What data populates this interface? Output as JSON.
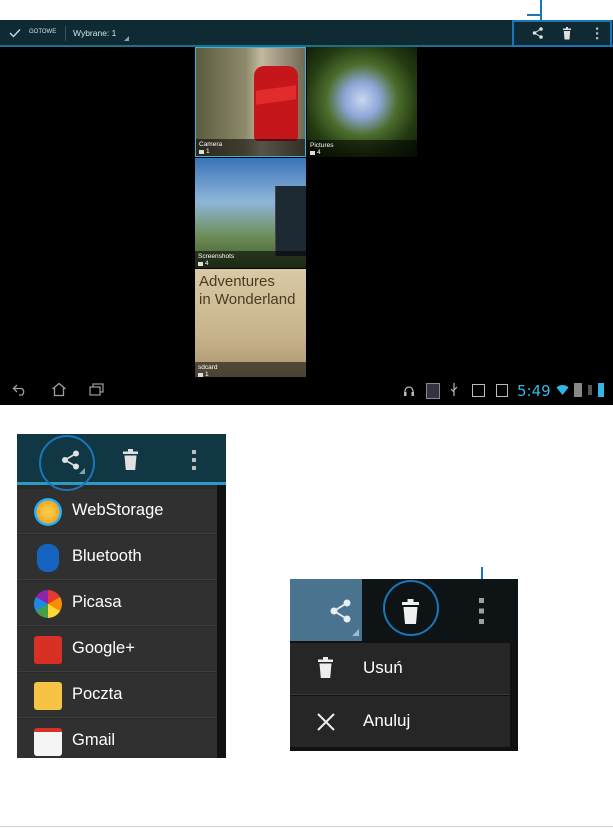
{
  "action_bar": {
    "done_label": "GOTOWE",
    "selected_label": "Wybrane: 1"
  },
  "gallery": {
    "albums": [
      {
        "name": "Camera",
        "count": "1"
      },
      {
        "name": "Pictures",
        "count": "4"
      },
      {
        "name": "Screenshots",
        "count": "4"
      },
      {
        "name": "sdcard",
        "count": "1"
      }
    ],
    "sdcard_title_line1": "Adventures",
    "sdcard_title_line2": "in Wonderland"
  },
  "status_bar": {
    "time": "5:49"
  },
  "share_menu": {
    "items": [
      {
        "label": "WebStorage",
        "icon": "webstorage-icon"
      },
      {
        "label": "Bluetooth",
        "icon": "bluetooth-icon"
      },
      {
        "label": "Picasa",
        "icon": "picasa-icon"
      },
      {
        "label": "Google+",
        "icon": "google-plus-icon"
      },
      {
        "label": "Poczta",
        "icon": "mail-icon"
      },
      {
        "label": "Gmail",
        "icon": "gmail-icon"
      }
    ]
  },
  "delete_menu": {
    "items": [
      {
        "label": "Usuń",
        "icon": "trash-icon"
      },
      {
        "label": "Anuluj",
        "icon": "close-icon"
      }
    ]
  },
  "colors": {
    "accent": "#33b5e5",
    "callout": "#1976b8",
    "action_bar": "#102a33"
  }
}
